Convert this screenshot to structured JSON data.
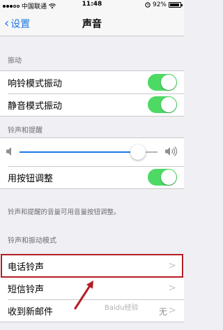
{
  "status_bar": {
    "carrier": "中国联通",
    "time": "11:48",
    "battery": "92%"
  },
  "nav": {
    "back_label": "设置",
    "title": "声音"
  },
  "vibration_section": {
    "header": "振动",
    "items": [
      {
        "label": "响铃模式振动",
        "on": true
      },
      {
        "label": "静音模式振动",
        "on": true
      }
    ]
  },
  "ringer_section": {
    "header": "铃声和提醒",
    "volume_fraction": 0.86,
    "adjust_label": "用按钮调整",
    "adjust_on": true,
    "footnote": "铃声和提醒的音量可用音量按钮调整。"
  },
  "patterns_section": {
    "header": "铃声和振动模式",
    "items": [
      {
        "label": "电话铃声"
      },
      {
        "label": "短信铃声"
      },
      {
        "label": "收到新邮件",
        "value": "无"
      }
    ]
  },
  "watermark": "Baidu经验",
  "colors": {
    "accent": "#1e78e6",
    "toggle_on": "#4cd964",
    "highlight": "#b21e24"
  }
}
